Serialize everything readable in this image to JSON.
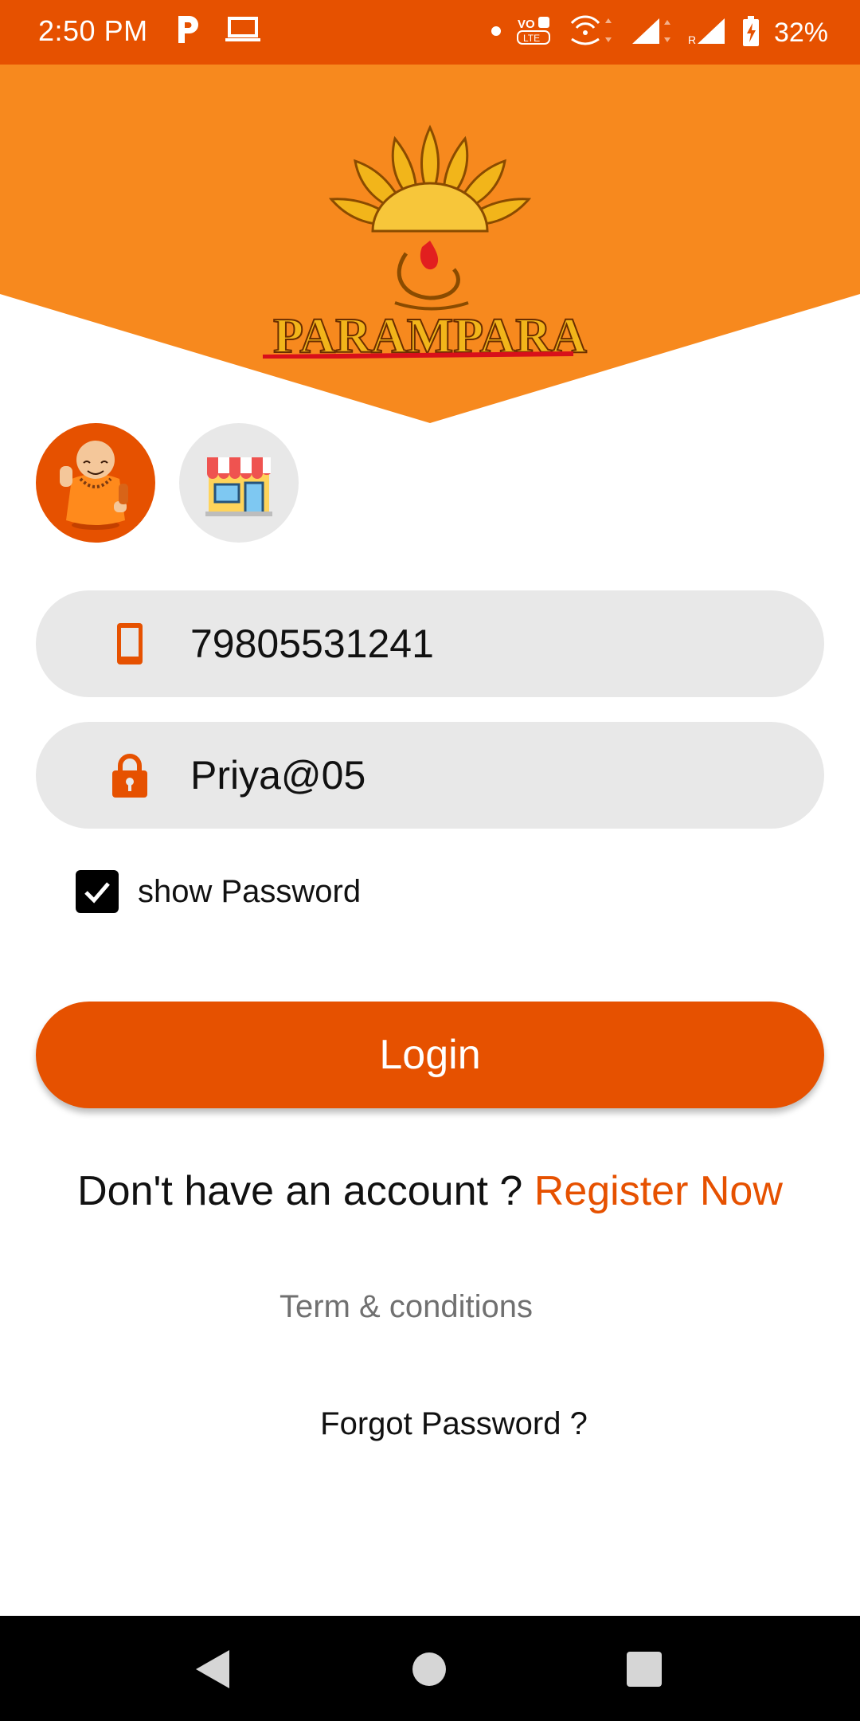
{
  "status_bar": {
    "time": "2:50 PM",
    "battery": "32%",
    "left_icons": [
      "parking-app-icon",
      "laptop-icon"
    ],
    "right_icons": [
      "dot-icon",
      "volte-icon",
      "wifi-calling-icon",
      "signal-icon",
      "signal-roaming-icon",
      "battery-charging-icon"
    ]
  },
  "header": {
    "brand_name": "PARAMPARA",
    "colors": {
      "primary": "#e65100",
      "header": "#f7891e",
      "logo_gold": "#f2b51a"
    }
  },
  "roles": [
    {
      "name": "monk-role",
      "icon": "monk-avatar-icon",
      "selected": true
    },
    {
      "name": "shop-role",
      "icon": "shop-icon",
      "selected": false
    }
  ],
  "form": {
    "phone": {
      "icon": "phone-icon",
      "value": "79805531241"
    },
    "password": {
      "icon": "lock-icon",
      "value": "Priya@05"
    },
    "show_password": {
      "label": "show Password",
      "checked": true
    }
  },
  "actions": {
    "login_label": "Login",
    "no_account_text": "Don't have an account ?",
    "register_label": "Register Now",
    "terms_label": "Term & conditions",
    "forgot_label": "Forgot Password ?"
  },
  "nav_bar": {
    "buttons": [
      "back-icon",
      "home-icon",
      "recents-icon"
    ]
  }
}
